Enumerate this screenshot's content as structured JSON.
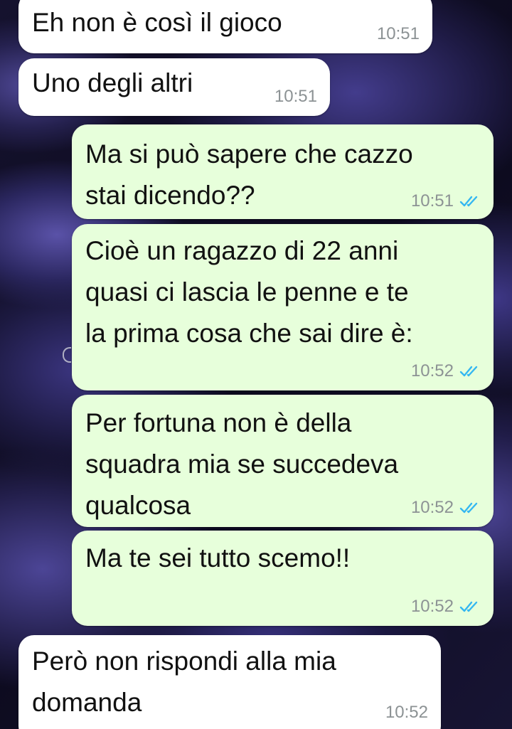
{
  "conversation": {
    "messages": [
      {
        "direction": "incoming",
        "text": "Eh non è così il gioco",
        "time": "10:51"
      },
      {
        "direction": "incoming",
        "text": "Uno degli altri",
        "time": "10:51"
      },
      {
        "direction": "outgoing",
        "text": "Ma si può sapere che cazzo\nstai dicendo??",
        "time": "10:51",
        "status": "read"
      },
      {
        "direction": "outgoing",
        "text": "Cioè un ragazzo di 22 anni\nquasi ci lascia le penne e te\nla prima cosa che sai dire è:",
        "time": "10:52",
        "status": "read"
      },
      {
        "direction": "outgoing",
        "text": "Per fortuna non è della\nsquadra mia se succedeva\nqualcosa",
        "time": "10:52",
        "status": "read"
      },
      {
        "direction": "outgoing",
        "text": "Ma te sei tutto scemo!!",
        "time": "10:52",
        "status": "read"
      },
      {
        "direction": "incoming",
        "text": "Però non rispondi alla mia\ndomanda",
        "time": "10:52"
      }
    ]
  },
  "colors": {
    "incoming_bubble": "#ffffff",
    "outgoing_bubble": "#e7ffdb",
    "read_ticks": "#34b7f1",
    "timestamp": "#8c9294"
  },
  "icons": {
    "read_status": "double-check-icon"
  }
}
